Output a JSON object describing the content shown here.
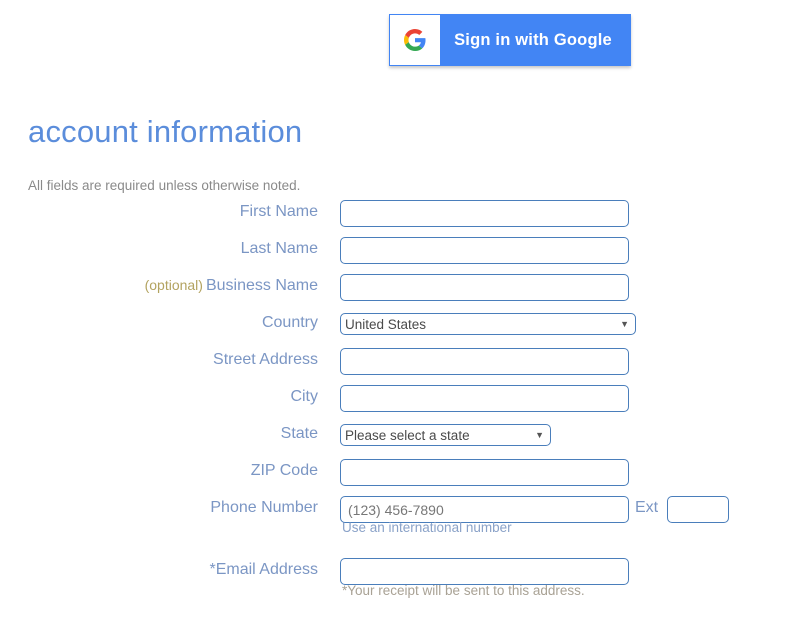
{
  "google_button": {
    "label": "Sign in with Google",
    "icon": "google-g-icon",
    "background_color": "#4285f4",
    "text_color": "#ffffff"
  },
  "heading": {
    "title": "account information",
    "title_color": "#5b8ddb",
    "subtitle": "All fields are required unless otherwise noted.",
    "subtitle_color": "#8a8a8a"
  },
  "form": {
    "label_color": "#7b96c4",
    "input_border_color": "#4a7ebb",
    "optional_color": "#b3a360",
    "fields": {
      "first_name": {
        "label": "First Name",
        "value": "",
        "placeholder": ""
      },
      "last_name": {
        "label": "Last Name",
        "value": "",
        "placeholder": ""
      },
      "business_name": {
        "optional_tag": "(optional)",
        "label": "Business Name",
        "value": "",
        "placeholder": ""
      },
      "country": {
        "label": "Country",
        "selected": "United States",
        "options": [
          "United States"
        ],
        "arrow": "▼"
      },
      "street_address": {
        "label": "Street Address",
        "value": "",
        "placeholder": ""
      },
      "city": {
        "label": "City",
        "value": "",
        "placeholder": ""
      },
      "state": {
        "label": "State",
        "selected": "Please select a state",
        "options": [
          "Please select a state"
        ],
        "arrow": "▼"
      },
      "zip_code": {
        "label": "ZIP Code",
        "value": "",
        "placeholder": ""
      },
      "phone_number": {
        "label": "Phone Number",
        "value": "",
        "placeholder": "(123) 456-7890",
        "ext_label": "Ext",
        "ext_value": "",
        "helper_link": "Use an international number"
      },
      "email_address": {
        "label": "*Email Address",
        "star": "*",
        "label_text": "Email Address",
        "value": "",
        "placeholder": "",
        "note": "*Your receipt will be sent to this address.",
        "note_color": "#a9a295"
      }
    }
  }
}
